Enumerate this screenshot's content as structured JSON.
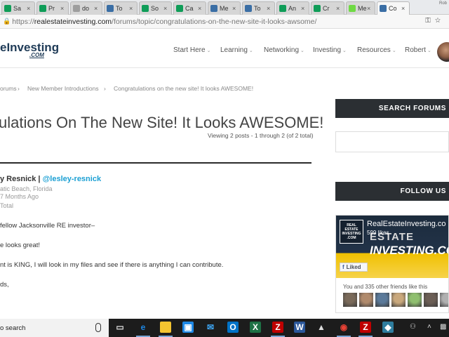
{
  "browser": {
    "tabs": [
      {
        "label": "Sa",
        "favicon": "sheets-icon",
        "color": "#0f9d58",
        "active": false
      },
      {
        "label": "Pr",
        "favicon": "sheets-icon",
        "color": "#0f9d58",
        "active": false
      },
      {
        "label": "do",
        "favicon": "document-icon",
        "color": "#9e9e9e",
        "active": false
      },
      {
        "label": "To",
        "favicon": "rei-icon",
        "color": "#3a6ea5",
        "active": false
      },
      {
        "label": "So",
        "favicon": "sheets-icon",
        "color": "#0f9d58",
        "active": false
      },
      {
        "label": "Ca",
        "favicon": "sheets-icon",
        "color": "#0f9d58",
        "active": false
      },
      {
        "label": "Me",
        "favicon": "rei-icon",
        "color": "#3a6ea5",
        "active": false
      },
      {
        "label": "To",
        "favicon": "rei-icon",
        "color": "#3a6ea5",
        "active": false
      },
      {
        "label": "An",
        "favicon": "sheets-icon",
        "color": "#0f9d58",
        "active": false
      },
      {
        "label": "Cr",
        "favicon": "sheets-icon",
        "color": "#0f9d58",
        "active": false
      },
      {
        "label": "Me",
        "favicon": "upwork-icon",
        "color": "#6fda44",
        "active": false
      },
      {
        "label": "Co",
        "favicon": "rei-icon",
        "color": "#3a6ea5",
        "active": true
      }
    ],
    "profile_label": "Rob",
    "url_prefix": "https://",
    "url_host": "realestateinvesting.com",
    "url_path": "/forums/topic/congratulations-on-the-new-site-it-looks-awsome/"
  },
  "site": {
    "logo_text": "eInvesting",
    "logo_sub": ".COM",
    "nav": [
      "Start Here",
      "Learning",
      "Networking",
      "Investing",
      "Resources",
      "Robert"
    ]
  },
  "breadcrumb": {
    "items": [
      "orums",
      "New Member Introductions",
      "Congratulations on the new site! It looks AWESOME!"
    ],
    "separator": "›"
  },
  "topic": {
    "title": "ulations On The New Site! It Looks AWESOME!",
    "viewing": "Viewing 2 posts - 1 through 2 (of 2 total)"
  },
  "post": {
    "author_name": "y Resnick |",
    "author_handle": "@lesley-resnick",
    "location": "atic Beach, Florida",
    "time_ago": "7 Months Ago",
    "total": "Total",
    "lines": [
      "fellow Jacksonville RE investor–",
      "e looks great!",
      "nt is KING, I will look in my files and see if there is anything I can contribute.",
      "ds,"
    ]
  },
  "sidebar": {
    "search_heading": "SEARCH FORUMS",
    "follow_heading": "FOLLOW US",
    "fb": {
      "page_name": "RealEstateInvesting.co",
      "likes": "599 likes",
      "banner_line1": "ESTATE",
      "banner_line2": "INVESTING.CO",
      "logo_text": "REAL ESTATE INVESTING .COM",
      "liked_label": "Liked",
      "friends_text": "You and 335 other friends like this"
    }
  },
  "taskbar": {
    "search_label": "o search",
    "apps": [
      "task-view-icon",
      "edge-icon",
      "file-explorer-icon",
      "store-icon",
      "mail-icon",
      "outlook-icon",
      "excel-icon",
      "filezilla-icon",
      "word-icon",
      "photos-icon",
      "chrome-icon",
      "filezilla-icon",
      "maps-icon"
    ]
  }
}
